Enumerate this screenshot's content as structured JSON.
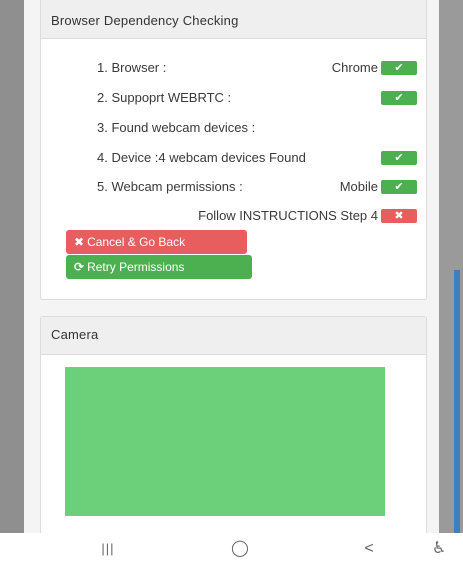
{
  "browser_check": {
    "title": "Browser Dependency Checking",
    "rows": [
      {
        "label": "1. Browser :",
        "value": "Chrome",
        "status": "ok",
        "icon": "check-icon"
      },
      {
        "label": "2. Suppoprt WEBRTC :",
        "value": "",
        "status": "ok",
        "icon": "check-icon"
      },
      {
        "label": "3. Found webcam devices :",
        "value": "",
        "status": "",
        "icon": ""
      },
      {
        "label": "4. Device :4 webcam devices Found",
        "value": "",
        "status": "ok",
        "icon": "check-icon"
      },
      {
        "label": "5. Webcam permissions :",
        "value": "Mobile",
        "status": "ok",
        "icon": "check-icon"
      }
    ],
    "instruction": {
      "text": "Follow INSTRUCTIONS Step 4",
      "status": "fail",
      "icon": "close-icon"
    },
    "cancel_label": "Cancel & Go Back",
    "retry_label": "Retry Permissions"
  },
  "camera": {
    "title": "Camera",
    "preview_color": "#6ccf7a"
  },
  "colors": {
    "ok": "#4caf50",
    "fail": "#e85d5d"
  },
  "android_nav": {
    "recents": "|||",
    "home": "◯",
    "back": "<",
    "accessibility": "♿"
  }
}
